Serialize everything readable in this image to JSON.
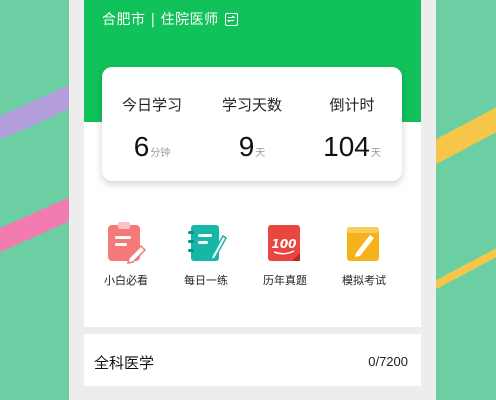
{
  "header": {
    "location_role": "合肥市 | 住院医师",
    "switch_icon": "switch-icon"
  },
  "stats": [
    {
      "label": "今日学习",
      "value": "6",
      "unit": "分钟"
    },
    {
      "label": "学习天数",
      "value": "9",
      "unit": "天"
    },
    {
      "label": "倒计时",
      "value": "104",
      "unit": "天"
    }
  ],
  "shortcuts": [
    {
      "label": "小白必看",
      "icon": "clipboard-pen-icon",
      "color": "#f47a7a"
    },
    {
      "label": "每日一练",
      "icon": "notebook-pen-icon",
      "color": "#17b7a8"
    },
    {
      "label": "历年真题",
      "icon": "score-100-icon",
      "color": "#e9463f"
    },
    {
      "label": "模拟考试",
      "icon": "exam-pencil-icon",
      "color": "#f5b21a"
    }
  ],
  "subject": {
    "name": "全科医学",
    "progress": "0/7200"
  },
  "colors": {
    "background": "#6ccfa4",
    "header_green": "#11c15a",
    "page_gray": "#ededee"
  }
}
